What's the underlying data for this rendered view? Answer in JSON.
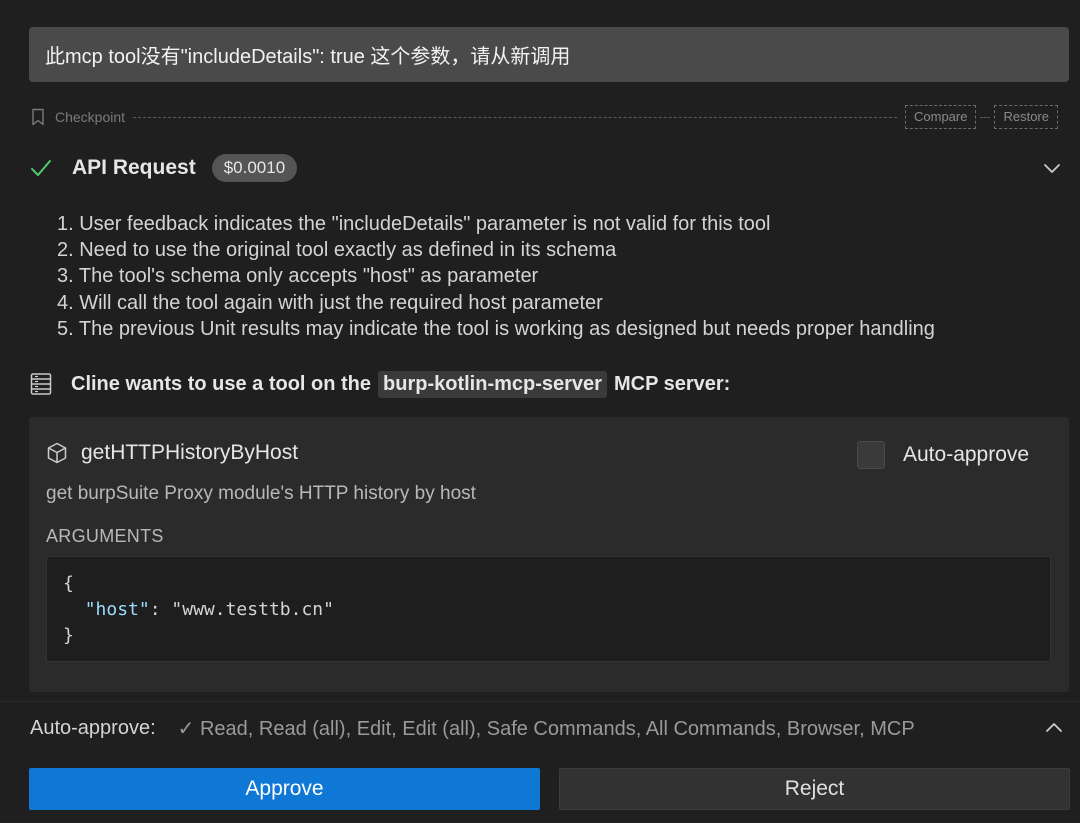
{
  "user_message": "此mcp tool没有\"includeDetails\": true 这个参数，请从新调用",
  "checkpoint": {
    "label": "Checkpoint",
    "compare_label": "Compare",
    "restore_label": "Restore",
    "icon": "bookmark-icon"
  },
  "api_request": {
    "title": "API Request",
    "cost": "$0.0010",
    "status_icon": "check-icon",
    "status_color": "#4ec96f"
  },
  "reasoning": [
    "1. User feedback indicates the \"includeDetails\" parameter is not valid for this tool",
    "2. Need to use the original tool exactly as defined in its schema",
    "3. The tool's schema only accepts \"host\" as parameter",
    "4. Will call the tool again with just the required host parameter",
    "5. The previous Unit results may indicate the tool is working as designed but needs proper handling"
  ],
  "tool_request": {
    "prefix": "Cline wants to use a tool on the",
    "server": "burp-kotlin-mcp-server",
    "suffix": "MCP server:"
  },
  "tool": {
    "name": "getHTTPHistoryByHost",
    "auto_approve_label": "Auto-approve",
    "auto_approve_checked": false,
    "description": "get burpSuite Proxy module's HTTP history by host",
    "arguments_label": "ARGUMENTS",
    "arguments": {
      "open": "{",
      "key": "\"host\"",
      "sep": ": ",
      "value": "\"www.testtb.cn\"",
      "close": "}"
    }
  },
  "auto_approve_bar": {
    "label": "Auto-approve:",
    "permissions": "✓ Read, Read (all), Edit, Edit (all), Safe Commands, All Commands, Browser, MCP"
  },
  "buttons": {
    "approve": "Approve",
    "reject": "Reject"
  },
  "colors": {
    "accent": "#0e78d4",
    "background": "#1f1f1f",
    "card": "#2b2b2b",
    "json_key": "#9cdcfe"
  }
}
